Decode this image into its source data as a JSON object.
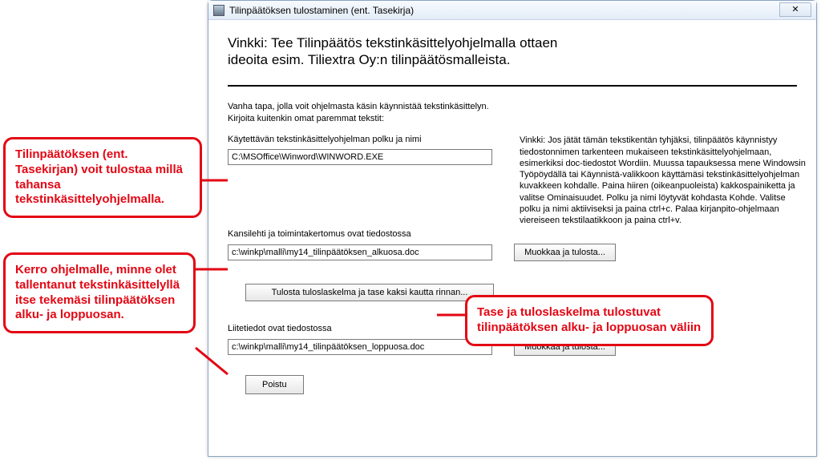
{
  "window": {
    "title": "Tilinpäätöksen tulostaminen (ent. Tasekirja)",
    "close_glyph": "✕"
  },
  "hint": {
    "line1": "Vinkki: Tee Tilinpäätös tekstinkäsittelyohjelmalla ottaen",
    "line2": "ideoita esim. Tiliextra Oy:n tilinpäätösmalleista."
  },
  "subtext": {
    "line1": "Vanha tapa, jolla voit ohjelmasta käsin käynnistää tekstinkäsittelyn.",
    "line2": "Kirjoita kuitenkin omat paremmat tekstit:"
  },
  "section1": {
    "label": "Käytettävän tekstinkäsittelyohjelman polku ja nimi",
    "value": "C:\\MSOffice\\Winword\\WINWORD.EXE",
    "right_hint": "Vinkki: Jos jätät tämän tekstikentän tyhjäksi, tilinpäätös käynnistyy tiedostonnimen tarkenteen mukaiseen tekstinkäsittelyohjelmaan, esimerkiksi doc-tiedostot Wordiin. Muussa tapauksessa mene Windowsin Työpöydällä tai Käynnistä-valikkoon käyttämäsi tekstinkäsittelyohjelman kuvakkeen kohdalle. Paina hiiren (oikeanpuoleista) kakkospainiketta ja valitse Ominaisuudet. Polku ja nimi löytyvät kohdasta Kohde. Valitse polku ja nimi aktiiviseksi ja paina ctrl+c. Palaa kirjanpito-ohjelmaan viereiseen tekstilaatikkoon ja paina ctrl+v."
  },
  "section2": {
    "label": "Kansilehti ja toimintakertomus ovat tiedostossa",
    "value": "c:\\winkp\\malli\\my14_tilinpäätöksen_alkuosa.doc",
    "btn": "Muokkaa ja tulosta..."
  },
  "section3": {
    "btn": "Tulosta tuloslaskelma ja tase kaksi kautta rinnan..."
  },
  "section4": {
    "label": "Liitetiedot ovat tiedostossa",
    "value": "c:\\winkp\\malli\\my14_tilinpäätöksen_loppuosa.doc",
    "btn": "Muokkaa ja tulosta..."
  },
  "exit_btn": "Poistu",
  "callouts": {
    "c1": "Tilinpäätöksen (ent. Tasekirjan) voit tulostaa millä tahansa tekstinkäsittelyohjelmalla.",
    "c2": "Kerro ohjelmalle, minne olet tallentanut tekstinkäsittelyllä itse tekemäsi tilinpäätöksen alku- ja loppuosan.",
    "c3": "Tase ja tuloslaskelma tulostuvat tilinpäätöksen alku- ja loppuosan väliin"
  }
}
